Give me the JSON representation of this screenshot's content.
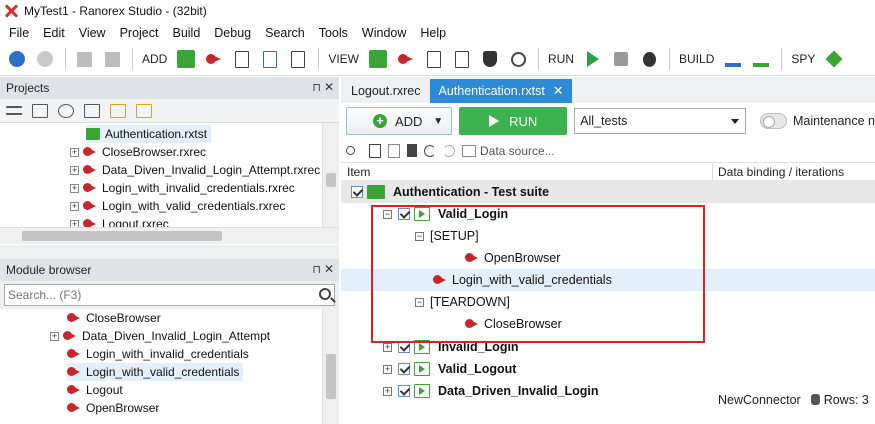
{
  "window": {
    "title": "MyTest1 - Ranorex Studio - (32bit)"
  },
  "menu": [
    "File",
    "Edit",
    "View",
    "Project",
    "Build",
    "Debug",
    "Search",
    "Tools",
    "Window",
    "Help"
  ],
  "toolbar": {
    "add_label": "ADD",
    "view_label": "VIEW",
    "run_label": "RUN",
    "build_label": "BUILD",
    "spy_label": "SPY"
  },
  "projects": {
    "title": "Projects",
    "pin": "⊓",
    "close": "✕",
    "items": [
      "Authentication.rxtst",
      "CloseBrowser.rxrec",
      "Data_Diven_Invalid_Login_Attempt.rxrec",
      "Login_with_invalid_credentials.rxrec",
      "Login_with_valid_credentials.rxrec",
      "Logout.rxrec"
    ]
  },
  "module_browser": {
    "title": "Module browser",
    "search_placeholder": "Search... (F3)",
    "items": [
      "CloseBrowser",
      "Data_Diven_Invalid_Login_Attempt",
      "Login_with_invalid_credentials",
      "Login_with_valid_credentials",
      "Logout",
      "OpenBrowser"
    ]
  },
  "tabs": [
    {
      "label": "Logout.rxrec"
    },
    {
      "label": "Authentication.rxtst",
      "close": "✕"
    }
  ],
  "actions": {
    "add": "ADD",
    "run": "RUN",
    "selected": "All_tests",
    "maintenance": "Maintenance n"
  },
  "edit": {
    "data_source": "Data source..."
  },
  "columns": {
    "item": "Item",
    "data_binding": "Data binding / iterations"
  },
  "suite": {
    "root": "Authentication - Test suite",
    "rows": [
      {
        "label": "Valid_Login"
      },
      {
        "label": "[SETUP]"
      },
      {
        "label": "OpenBrowser"
      },
      {
        "label": "Login_with_valid_credentials"
      },
      {
        "label": "[TEARDOWN]"
      },
      {
        "label": "CloseBrowser"
      },
      {
        "label": "Invalid_Login"
      },
      {
        "label": "Valid_Logout"
      },
      {
        "label": "Data_Driven_Invalid_Login"
      }
    ],
    "connector": "NewConnector",
    "rows_count": "Rows: 3"
  }
}
